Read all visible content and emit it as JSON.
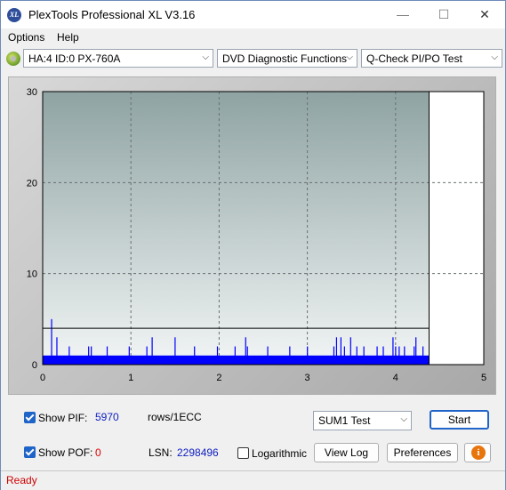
{
  "window": {
    "title": "PlexTools Professional XL V3.16",
    "logo_text": "XL",
    "minimize": "—",
    "maximize": "☐",
    "close": "✕"
  },
  "menu": {
    "options": "Options",
    "help": "Help"
  },
  "toolbar": {
    "drive": "HA:4 ID:0  PX-760A",
    "function": "DVD Diagnostic Functions",
    "test": "Q-Check PI/PO Test"
  },
  "chart_data": {
    "type": "bar",
    "title": "",
    "xlabel": "",
    "ylabel": "",
    "xlim": [
      0,
      5
    ],
    "ylim": [
      0,
      30
    ],
    "xticks": [
      "0",
      "1",
      "2",
      "3",
      "4",
      "5"
    ],
    "yticks": [
      "0",
      "10",
      "20",
      "30"
    ],
    "grid": true,
    "threshold": 4,
    "data_end_x": 4.38,
    "series": [
      {
        "color": "#0000ff",
        "baseline": 1,
        "x": [
          0.1,
          0.16,
          0.3,
          0.52,
          0.55,
          0.73,
          0.98,
          1.18,
          1.24,
          1.5,
          1.72,
          1.98,
          2.18,
          2.3,
          2.32,
          2.55,
          2.8,
          3.0,
          3.3,
          3.33,
          3.38,
          3.42,
          3.49,
          3.56,
          3.64,
          3.79,
          3.86,
          3.97,
          4.0,
          4.04,
          4.1,
          4.21,
          4.23,
          4.31
        ],
        "values": [
          5,
          3,
          2,
          2,
          2,
          2,
          2,
          2,
          3,
          3,
          2,
          2,
          2,
          3,
          2,
          2,
          2,
          2,
          2,
          3,
          3,
          2,
          3,
          2,
          2,
          2,
          2,
          3,
          2,
          2,
          2,
          2,
          3,
          2
        ]
      }
    ]
  },
  "controls": {
    "show_pif_label": "Show PIF:",
    "pif_value": "5970",
    "pif_unit": "rows/1ECC",
    "show_pof_label": "Show POF:",
    "pof_value": "0",
    "lsn_label": "LSN:",
    "lsn_value": "2298496",
    "logarithmic_label": "Logarithmic",
    "sum_select": "SUM1 Test",
    "start": "Start",
    "view_log": "View Log",
    "preferences": "Preferences",
    "info_glyph": "i",
    "pif_color": "#1020c0",
    "pof_color": "#e00000"
  },
  "status": {
    "text": "Ready"
  }
}
